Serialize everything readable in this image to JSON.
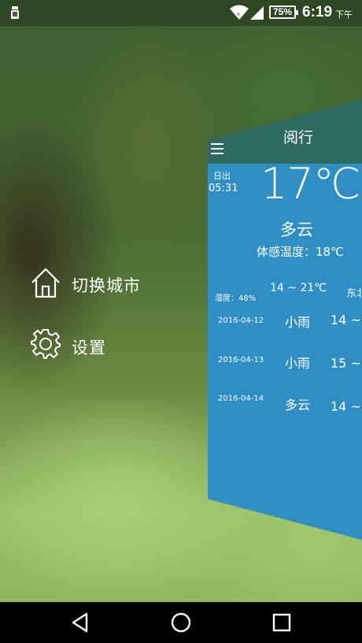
{
  "status_bar": {
    "battery": "75%",
    "time": "6:19",
    "ampm": "下午",
    "icons": [
      "notification-icon",
      "wifi-icon",
      "signal-icon",
      "battery-icon"
    ]
  },
  "menu": {
    "items": [
      {
        "label": "切换城市",
        "icon": "home-icon"
      },
      {
        "label": "设置",
        "icon": "gear-icon"
      }
    ]
  },
  "weather": {
    "city": "阅行",
    "sunrise_label": "日出",
    "sunrise_time": "05:31",
    "temperature": "17℃",
    "condition": "多云",
    "feels_like": "体感温度：18℃",
    "humidity": "湿度：48%",
    "range": "14 ~ 21℃",
    "wind": "东北",
    "forecast": [
      {
        "date": "2016-04-12",
        "condition": "小雨",
        "temp": "14 ~"
      },
      {
        "date": "2016-04-13",
        "condition": "小雨",
        "temp": "15 ~"
      },
      {
        "date": "2016-04-14",
        "condition": "多云",
        "temp": "14 ~"
      }
    ]
  },
  "colors": {
    "card_header": "#2e6a62",
    "card_body": "#2f8fc4",
    "nav_bar": "#000000"
  }
}
